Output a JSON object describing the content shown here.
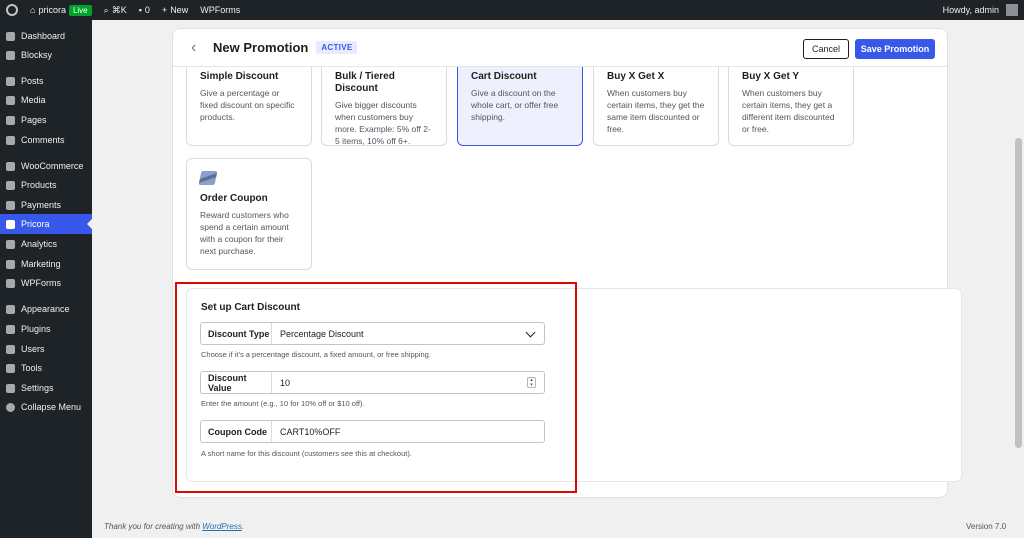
{
  "adminbar": {
    "site_name": "pricora",
    "live_badge": "Live",
    "shortcut": "⌘K",
    "comments_count": "0",
    "new_label": "New",
    "wpforms_label": "WPForms",
    "howdy": "Howdy, admin"
  },
  "sidebar": {
    "items": [
      {
        "label": "Dashboard",
        "icon": "dashboard-icon"
      },
      {
        "label": "Blocksy",
        "icon": "blocksy-icon"
      },
      {
        "label": "Posts",
        "icon": "pin-icon"
      },
      {
        "label": "Media",
        "icon": "media-icon"
      },
      {
        "label": "Pages",
        "icon": "pages-icon"
      },
      {
        "label": "Comments",
        "icon": "comments-icon"
      },
      {
        "label": "WooCommerce",
        "icon": "woocommerce-icon"
      },
      {
        "label": "Products",
        "icon": "products-icon"
      },
      {
        "label": "Payments",
        "icon": "payments-icon"
      },
      {
        "label": "Pricora",
        "icon": "pricora-icon"
      },
      {
        "label": "Analytics",
        "icon": "analytics-icon"
      },
      {
        "label": "Marketing",
        "icon": "megaphone-icon"
      },
      {
        "label": "WPForms",
        "icon": "wpforms-icon"
      },
      {
        "label": "Appearance",
        "icon": "brush-icon"
      },
      {
        "label": "Plugins",
        "icon": "plugins-icon"
      },
      {
        "label": "Users",
        "icon": "users-icon"
      },
      {
        "label": "Tools",
        "icon": "wrench-icon"
      },
      {
        "label": "Settings",
        "icon": "settings-icon"
      },
      {
        "label": "Collapse Menu",
        "icon": "collapse-icon"
      }
    ]
  },
  "header": {
    "title": "New Promotion",
    "status_badge": "ACTIVE",
    "cancel_label": "Cancel",
    "save_label": "Save Promotion"
  },
  "discount_types": [
    {
      "title": "Simple Discount",
      "description": "Give a percentage or fixed discount on specific products."
    },
    {
      "title": "Bulk / Tiered Discount",
      "description": "Give bigger discounts when customers buy more. Example: 5% off 2-5 items, 10% off 6+."
    },
    {
      "title": "Cart Discount",
      "description": "Give a discount on the whole cart, or offer free shipping."
    },
    {
      "title": "Buy X Get X",
      "description": "When customers buy certain items, they get the same item discounted or free."
    },
    {
      "title": "Buy X Get Y",
      "description": "When customers buy certain items, they get a different item discounted or free."
    },
    {
      "title": "Order Coupon",
      "description": "Reward customers who spend a certain amount with a coupon for their next purchase."
    }
  ],
  "selected_type": "Cart Discount",
  "setup": {
    "title": "Set up Cart Discount",
    "discount_type": {
      "label": "Discount Type",
      "value": "Percentage Discount",
      "help": "Choose if it's a percentage discount, a fixed amount, or free shipping."
    },
    "discount_value": {
      "label": "Discount Value",
      "value": "10",
      "help": "Enter the amount (e.g., 10 for 10% off or $10 off)."
    },
    "coupon_code": {
      "label": "Coupon Code",
      "value": "CART10%OFF",
      "help": "A short name for this discount (customers see this at checkout)."
    }
  },
  "footer": {
    "thanks_text": "Thank you for creating with",
    "wordpress_link": "WordPress",
    "version": "Version 7.0"
  },
  "colors": {
    "accent": "#3858e9",
    "highlight_border": "#e10600",
    "admin_bg": "#1d2327",
    "live_badge": "#00a32a"
  }
}
